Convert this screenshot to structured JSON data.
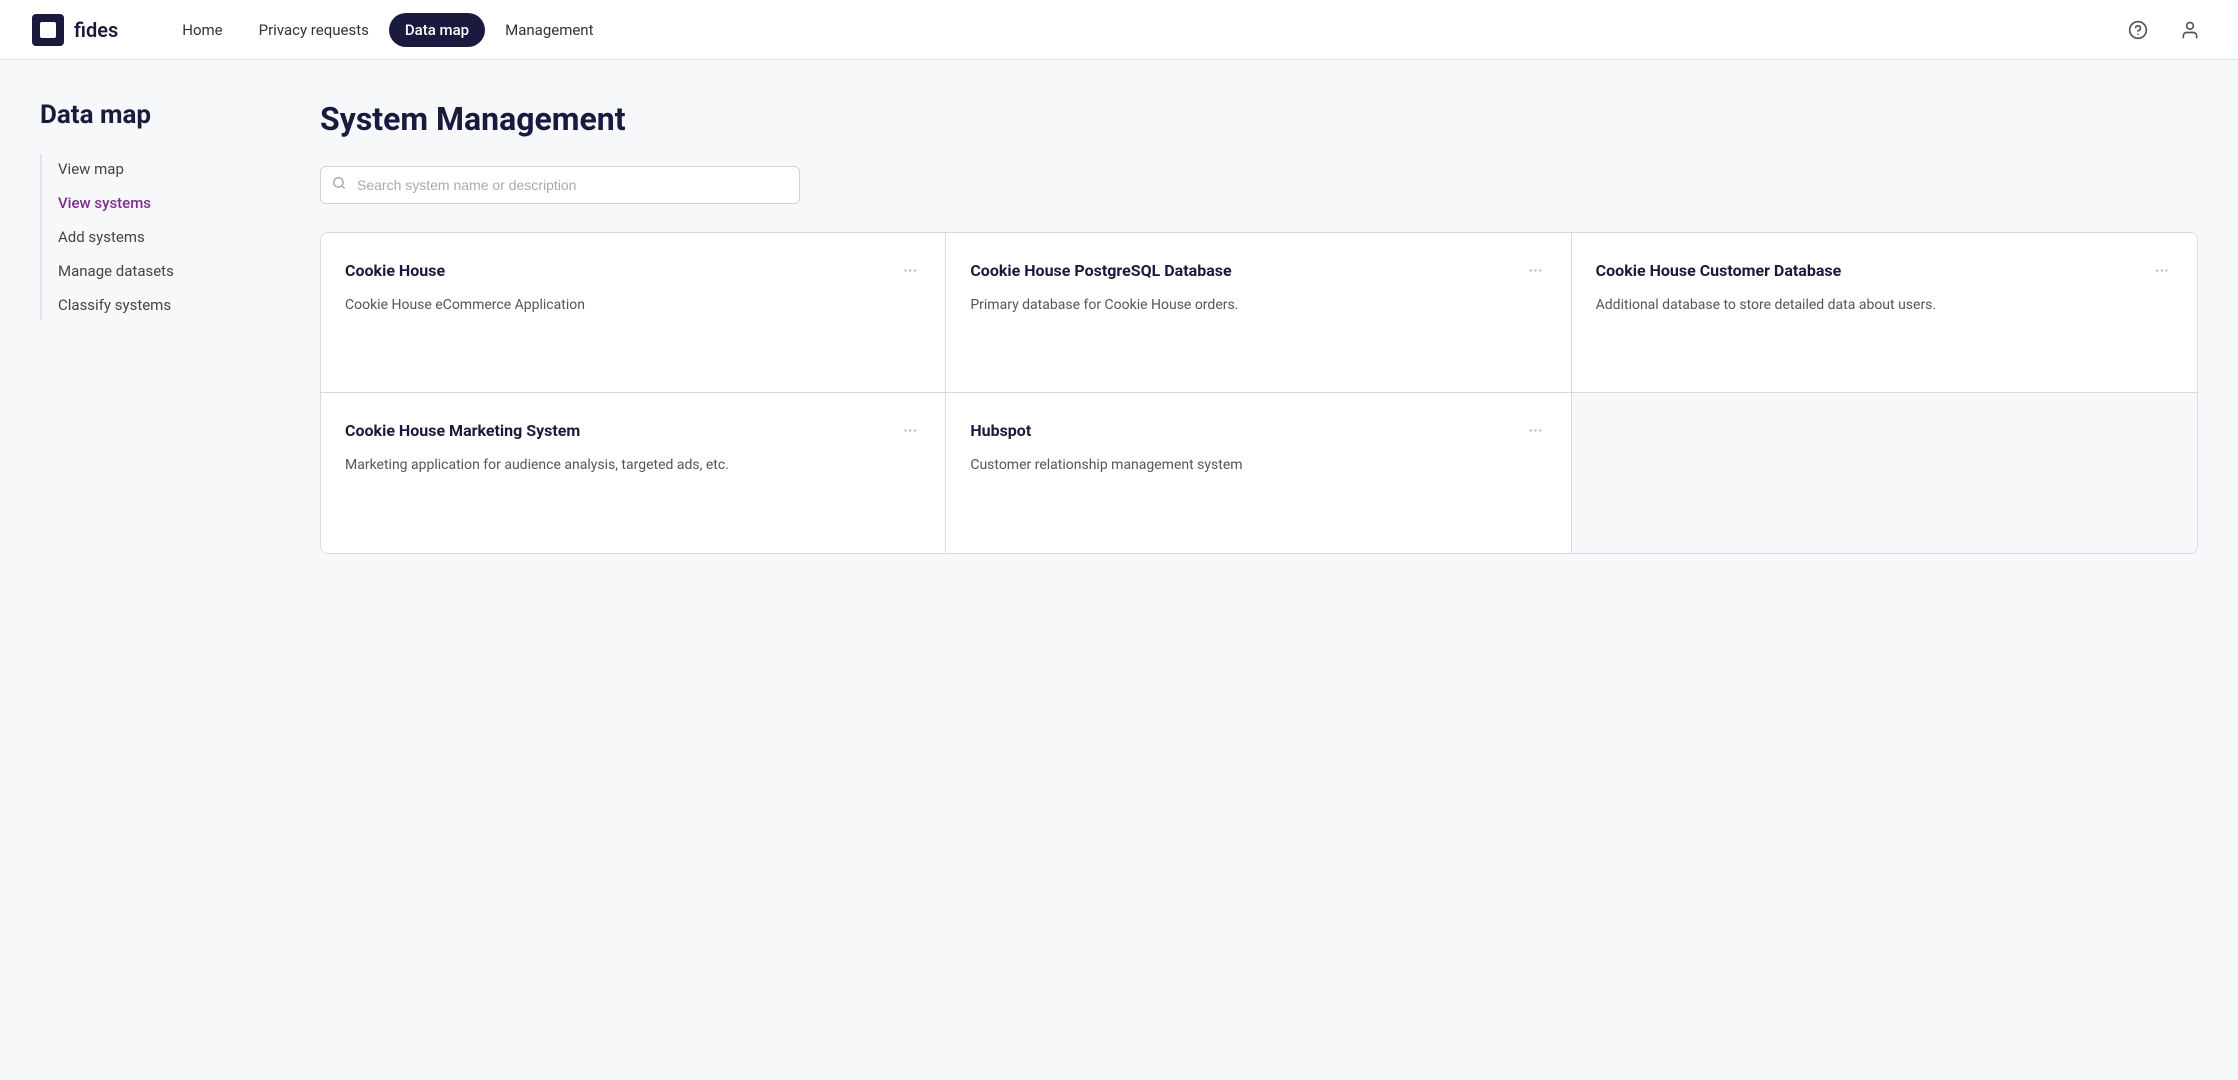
{
  "app": {
    "logo_text": "fides"
  },
  "top_nav": {
    "links": [
      {
        "id": "home",
        "label": "Home",
        "active": false
      },
      {
        "id": "privacy-requests",
        "label": "Privacy requests",
        "active": false
      },
      {
        "id": "data-map",
        "label": "Data map",
        "active": true
      },
      {
        "id": "management",
        "label": "Management",
        "active": false
      }
    ]
  },
  "sidebar": {
    "title": "Data map",
    "items": [
      {
        "id": "view-map",
        "label": "View map",
        "active": false
      },
      {
        "id": "view-systems",
        "label": "View systems",
        "active": true
      },
      {
        "id": "add-systems",
        "label": "Add systems",
        "active": false
      },
      {
        "id": "manage-datasets",
        "label": "Manage datasets",
        "active": false
      },
      {
        "id": "classify-systems",
        "label": "Classify systems",
        "active": false
      }
    ]
  },
  "main": {
    "title": "System Management",
    "search_placeholder": "Search system name or description"
  },
  "systems": [
    {
      "id": "cookie-house",
      "name": "Cookie House",
      "description": "Cookie House eCommerce Application"
    },
    {
      "id": "cookie-house-postgresql",
      "name": "Cookie House PostgreSQL Database",
      "description": "Primary database for Cookie House orders."
    },
    {
      "id": "cookie-house-customer",
      "name": "Cookie House Customer Database",
      "description": "Additional database to store detailed data about users."
    },
    {
      "id": "cookie-house-marketing",
      "name": "Cookie House Marketing System",
      "description": "Marketing application for audience analysis, targeted ads, etc."
    },
    {
      "id": "hubspot",
      "name": "Hubspot",
      "description": "Customer relationship management system"
    },
    {
      "id": "empty",
      "name": "",
      "description": ""
    }
  ]
}
